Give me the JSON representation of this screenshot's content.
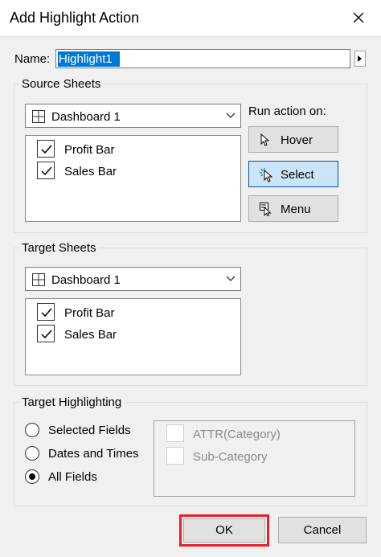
{
  "dialog": {
    "title": "Add Highlight Action"
  },
  "name": {
    "label": "Name:",
    "value": "Highlight1"
  },
  "source": {
    "group_label": "Source Sheets",
    "dashboard": "Dashboard 1",
    "sheets": [
      {
        "label": "Profit Bar",
        "checked": true
      },
      {
        "label": "Sales Bar",
        "checked": true
      }
    ],
    "run_label": "Run action on:",
    "run_buttons": [
      {
        "label": "Hover",
        "icon": "pointer-icon",
        "selected": false
      },
      {
        "label": "Select",
        "icon": "select-pointer-icon",
        "selected": true
      },
      {
        "label": "Menu",
        "icon": "menu-icon",
        "selected": false
      }
    ]
  },
  "target": {
    "group_label": "Target Sheets",
    "dashboard": "Dashboard 1",
    "sheets": [
      {
        "label": "Profit Bar",
        "checked": true
      },
      {
        "label": "Sales Bar",
        "checked": true
      }
    ]
  },
  "highlighting": {
    "group_label": "Target Highlighting",
    "options": [
      {
        "label": "Selected Fields",
        "selected": false
      },
      {
        "label": "Dates and Times",
        "selected": false
      },
      {
        "label": "All Fields",
        "selected": true
      }
    ],
    "fields": [
      {
        "label": "ATTR(Category)",
        "checked": false
      },
      {
        "label": "Sub-Category",
        "checked": false
      }
    ]
  },
  "footer": {
    "ok": "OK",
    "cancel": "Cancel",
    "highlight_color": "#e8202a"
  }
}
